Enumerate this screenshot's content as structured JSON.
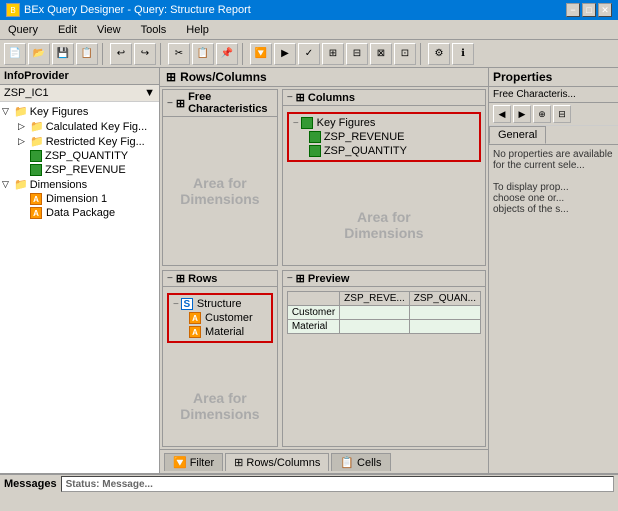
{
  "titlebar": {
    "title": "BEx Query Designer - Query: Structure Report",
    "icon": "BEx"
  },
  "menubar": {
    "items": [
      {
        "label": "Query"
      },
      {
        "label": "Edit"
      },
      {
        "label": "View"
      },
      {
        "label": "Tools"
      },
      {
        "label": "Help"
      }
    ]
  },
  "infoprovider": {
    "header": "InfoProvider",
    "provider_name": "ZSP_IC1",
    "tree": {
      "key_figures": {
        "label": "Key Figures",
        "children": [
          {
            "label": "Calculated Key Fig..."
          },
          {
            "label": "Restricted Key Fig..."
          },
          {
            "label": "ZSP_QUANTITY"
          },
          {
            "label": "ZSP_REVENUE"
          }
        ]
      },
      "dimensions": {
        "label": "Dimensions",
        "children": [
          {
            "label": "Dimension 1"
          },
          {
            "label": "Data Package"
          }
        ]
      }
    }
  },
  "rows_columns": {
    "header": "Rows/Columns",
    "free_characteristics": {
      "header": "Free Characteristics",
      "area_text": "Area for\nDimensions"
    },
    "columns": {
      "header": "Columns",
      "items": [
        {
          "label": "Key Figures"
        },
        {
          "label": "ZSP_REVENUE"
        },
        {
          "label": "ZSP_QUANTITY"
        }
      ]
    },
    "rows": {
      "header": "Rows",
      "structure": "Structure",
      "items": [
        {
          "label": "Customer"
        },
        {
          "label": "Material"
        }
      ]
    },
    "preview": {
      "header": "Preview",
      "columns": [
        "ZSP_REVE...",
        "ZSP_QUAN..."
      ],
      "rows": [
        {
          "label": "Customer"
        },
        {
          "label": "Material"
        }
      ]
    }
  },
  "properties": {
    "header": "Properties",
    "sub_header": "Free Characteris...",
    "tabs": [
      {
        "label": "General",
        "active": true
      }
    ],
    "content": "No properties are available for the current sele...\n\nTo display prop...\nchoose one or...\nobjects of the s..."
  },
  "bottom_tabs": [
    {
      "label": "Filter",
      "active": false
    },
    {
      "label": "Rows/Columns",
      "active": true
    },
    {
      "label": "Cells",
      "active": false
    }
  ],
  "messages": {
    "header": "Messages",
    "status": "Status: Message..."
  },
  "icons": {
    "filter": "🔽",
    "expand": "▷",
    "collapse": "▽",
    "minus": "−",
    "plus": "+",
    "folder": "📁",
    "gear": "⚙",
    "close": "✕",
    "minimize": "−",
    "maximize": "□"
  }
}
